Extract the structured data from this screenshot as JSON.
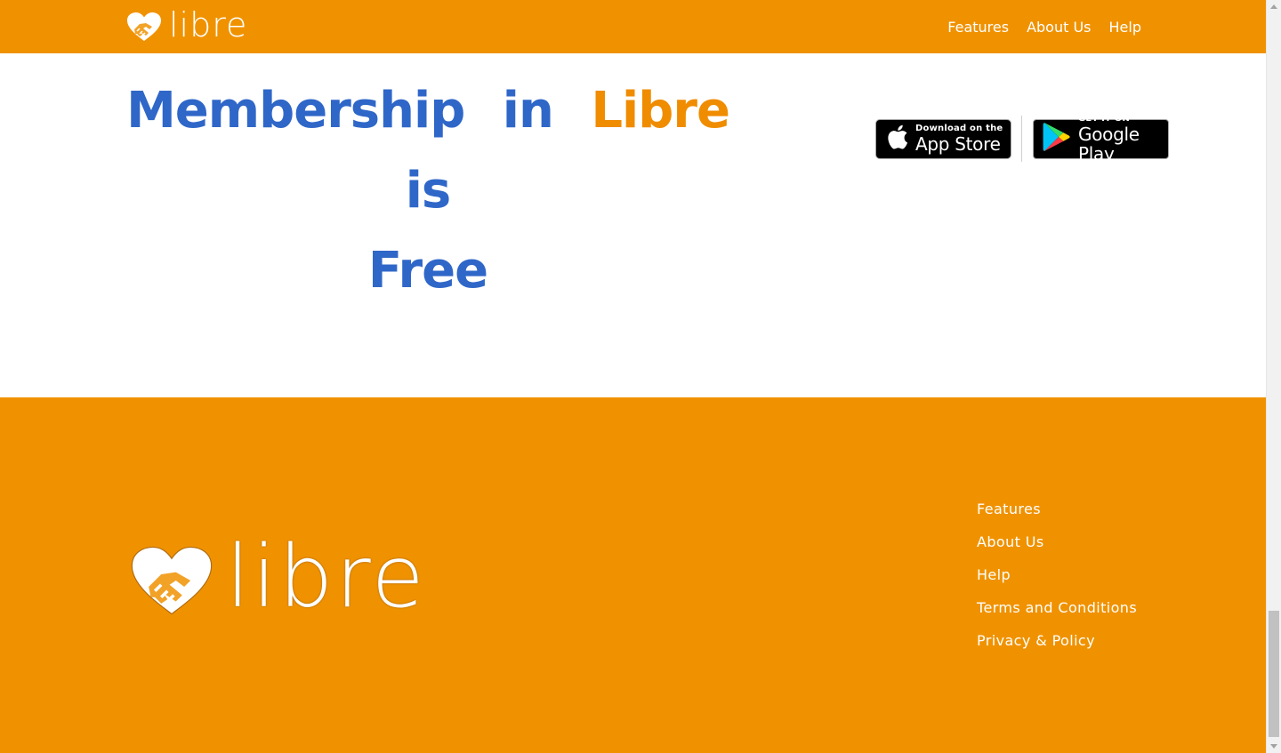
{
  "brand": {
    "logo_text": "libre",
    "primary_color": "#f09200",
    "accent_color": "#f08c00",
    "heading_color": "#2f67c8"
  },
  "header": {
    "nav": [
      {
        "label": "Features"
      },
      {
        "label": "About Us"
      },
      {
        "label": "Help"
      }
    ]
  },
  "hero": {
    "heading_words": [
      "Membership",
      "in",
      "Libre",
      "is",
      "Free"
    ],
    "highlight_word": "Libre"
  },
  "stores": {
    "apple": {
      "small": "Download on the",
      "big": "App Store",
      "icon": "apple-icon"
    },
    "google": {
      "small": "GET IT ON",
      "big": "Google Play",
      "icon": "google-play-icon"
    }
  },
  "footer": {
    "logo_text": "libre",
    "links": [
      {
        "label": "Features"
      },
      {
        "label": "About Us"
      },
      {
        "label": "Help"
      },
      {
        "label": "Terms and Conditions"
      },
      {
        "label": "Privacy & Policy"
      }
    ]
  }
}
